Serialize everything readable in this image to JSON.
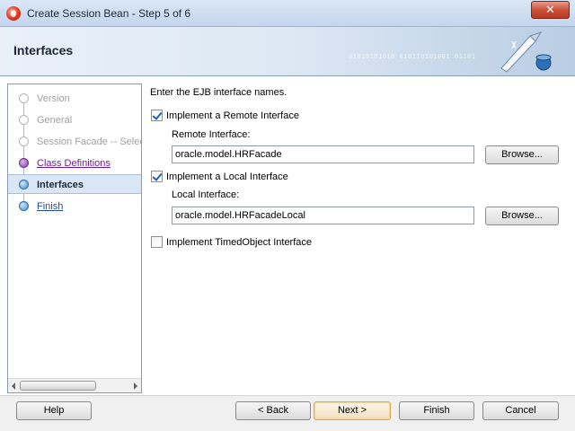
{
  "window": {
    "title": "Create Session Bean - Step 5 of 6",
    "close_glyph": "✕"
  },
  "header": {
    "title": "Interfaces",
    "binary_text": "01010101010 010110101001 01101"
  },
  "nav": {
    "items": [
      {
        "label": "Version",
        "state": "disabled"
      },
      {
        "label": "General",
        "state": "disabled"
      },
      {
        "label": "Session Facade -- Select",
        "state": "disabled"
      },
      {
        "label": "Class Definitions",
        "state": "visited"
      },
      {
        "label": "Interfaces",
        "state": "current"
      },
      {
        "label": "Finish",
        "state": "link"
      }
    ]
  },
  "content": {
    "instruction": "Enter the EJB interface names.",
    "remote": {
      "checkbox_label": "Implement a Remote Interface",
      "checked": true,
      "field_label": "Remote Interface:",
      "value": "oracle.model.HRFacade",
      "browse_label": "Browse..."
    },
    "local": {
      "checkbox_label": "Implement a Local Interface",
      "checked": true,
      "field_label": "Local Interface:",
      "value": "oracle.model.HRFacadeLocal",
      "browse_label": "Browse..."
    },
    "timed": {
      "checkbox_label": "Implement TimedObject Interface",
      "checked": false
    }
  },
  "footer": {
    "help": "Help",
    "back": "< Back",
    "next": "Next >",
    "finish": "Finish",
    "cancel": "Cancel"
  }
}
